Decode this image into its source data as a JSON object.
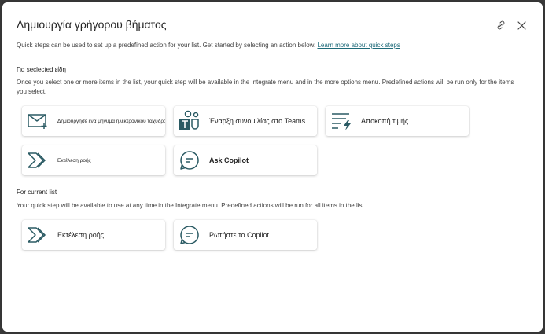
{
  "dialog": {
    "title": "Δημιουργία γρήγορου βήματος",
    "intro_text": "Quick steps can be used to set up a predefined action for your list. Get started by selecting an action below. ",
    "learn_more": "Learn more about quick steps"
  },
  "selected_section": {
    "title": "Για sесlеcted είδη",
    "description": "Once you select one or more items in the list, your quick step will be available in the Integrate menu and in the more options menu. Predefined actions will be run only for the items you select.",
    "tiles": [
      {
        "label": "Δημιούργησε ένα μήνυμα ηλεκτρονικού ταχυδρομείου",
        "icon": "mail-add-icon"
      },
      {
        "label": "Έναρξη συνομιλίας στο Teams",
        "icon": "teams-icon"
      },
      {
        "label": "Αποκοπή τιμής",
        "icon": "text-flash-icon"
      },
      {
        "label": "Εκτέλεση ροής",
        "icon": "flow-icon"
      },
      {
        "label": "Ask Copilot",
        "icon": "chat-icon"
      }
    ]
  },
  "current_section": {
    "title": "For current list",
    "description": "Your quick step will be available to use at any time in the Integrate menu. Predefined actions will be run for all items in the list.",
    "tiles": [
      {
        "label": "Εκτέλεση ροής",
        "icon": "flow-icon"
      },
      {
        "label": "Ρωτήστε το Copilot",
        "icon": "chat-icon"
      }
    ]
  },
  "colors": {
    "accent": "#1f6b7a",
    "icon": "#2a5a63"
  }
}
